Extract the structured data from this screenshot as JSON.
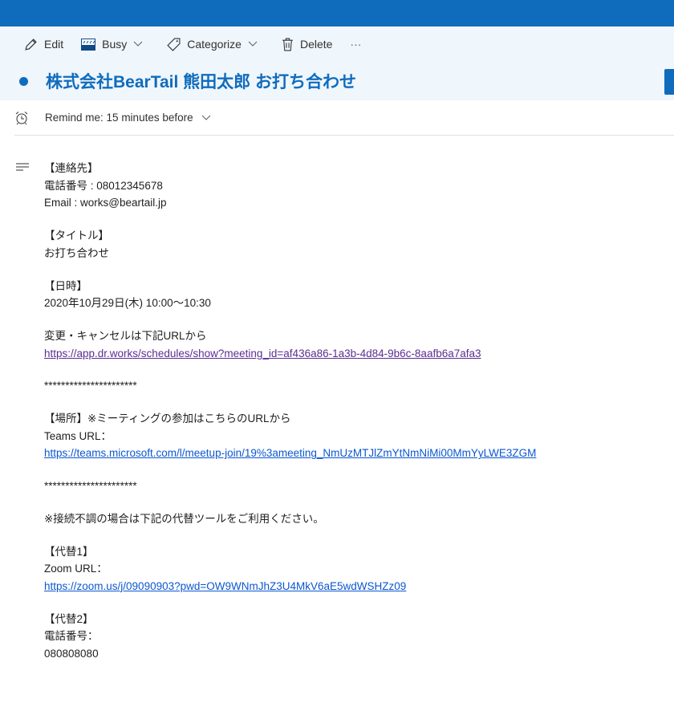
{
  "toolbar": {
    "edit": "Edit",
    "busy": "Busy",
    "categorize": "Categorize",
    "delete": "Delete",
    "more": "···"
  },
  "event": {
    "title": "株式会社BearTail 熊田太郎 お打ち合わせ"
  },
  "reminder": {
    "label": "Remind me:",
    "value": "15 minutes before"
  },
  "body": {
    "contact_h": "【連絡先】",
    "phone": "電話番号 : 08012345678",
    "email": "Email : works@beartail.jp",
    "title_h": "【タイトル】",
    "title": "お打ち合わせ",
    "date_h": "【日時】",
    "date": "2020年10月29日(木) 10:00〜10:30",
    "change": "変更・キャンセルは下記URLから",
    "change_url": "https://app.dr.works/schedules/show?meeting_id=af436a86-1a3b-4d84-9b6c-8aafb6a7afa3",
    "sep1": "**********************",
    "place_h": "【場所】※ミーティングの参加はこちらのURLから",
    "teams_label": "Teams URL：",
    "teams_url": "https://teams.microsoft.com/l/meetup-join/19%3ameeting_NmUzMTJlZmYtNmNiMi00MmYyLWE3ZGM",
    "sep2": "**********************",
    "note": "※接続不調の場合は下記の代替ツールをご利用ください。",
    "alt1_h": "【代替1】",
    "zoom_label": "Zoom URL：",
    "zoom_url": "https://zoom.us/j/09090903?pwd=OW9WNmJhZ3U4MkV6aE5wdWSHZz09",
    "alt2_h": "【代替2】",
    "alt2_label": "電話番号：",
    "alt2_phone": "080808080"
  }
}
